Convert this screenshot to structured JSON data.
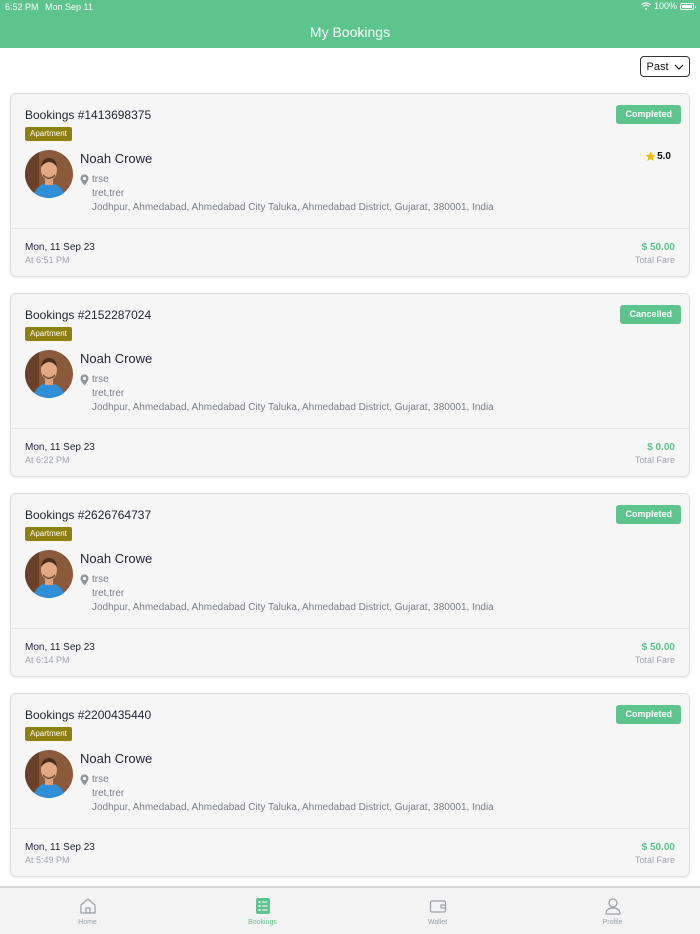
{
  "status_bar": {
    "time": "6:52 PM",
    "date": "Mon Sep 11",
    "battery": "100%"
  },
  "header": {
    "title": "My Bookings"
  },
  "filter": {
    "selected": "Past"
  },
  "bookings": [
    {
      "id_label": "Bookings #1413698375",
      "status": "Completed",
      "status_color": "#5cc48c",
      "tag": "Apartment",
      "name": "Noah Crowe",
      "rating": "5.0",
      "addr_line1": "trse",
      "addr_line2": "tret,trer",
      "addr_line3": "Jodhpur, Ahmedabad, Ahmedabad City Taluka, Ahmedabad District, Gujarat, 380001, India",
      "date": "Mon, 11 Sep 23",
      "time": "At 6:51 PM",
      "fare": "$ 50.00",
      "fare_label": "Total Fare"
    },
    {
      "id_label": "Bookings #2152287024",
      "status": "Cancelled",
      "status_color": "#5cc48c",
      "tag": "Apartment",
      "name": "Noah Crowe",
      "rating": "",
      "addr_line1": "trse",
      "addr_line2": "tret,trer",
      "addr_line3": "Jodhpur, Ahmedabad, Ahmedabad City Taluka, Ahmedabad District, Gujarat, 380001, India",
      "date": "Mon, 11 Sep 23",
      "time": "At 6:22 PM",
      "fare": "$ 0.00",
      "fare_label": "Total Fare"
    },
    {
      "id_label": "Bookings #2626764737",
      "status": "Completed",
      "status_color": "#5cc48c",
      "tag": "Apartment",
      "name": "Noah Crowe",
      "rating": "",
      "addr_line1": "trse",
      "addr_line2": "tret,trer",
      "addr_line3": "Jodhpur, Ahmedabad, Ahmedabad City Taluka, Ahmedabad District, Gujarat, 380001, India",
      "date": "Mon, 11 Sep 23",
      "time": "At 6:14 PM",
      "fare": "$ 50.00",
      "fare_label": "Total Fare"
    },
    {
      "id_label": "Bookings #2200435440",
      "status": "Completed",
      "status_color": "#5cc48c",
      "tag": "Apartment",
      "name": "Noah Crowe",
      "rating": "",
      "addr_line1": "trse",
      "addr_line2": "tret,trer",
      "addr_line3": "Jodhpur, Ahmedabad, Ahmedabad City Taluka, Ahmedabad District, Gujarat, 380001, India",
      "date": "Mon, 11 Sep 23",
      "time": "At 5:49 PM",
      "fare": "$ 50.00",
      "fare_label": "Total Fare"
    }
  ],
  "tabs": [
    {
      "label": "Home",
      "icon": "home-icon",
      "active": false
    },
    {
      "label": "Bookings",
      "icon": "bookings-icon",
      "active": true
    },
    {
      "label": "Wallet",
      "icon": "wallet-icon",
      "active": false
    },
    {
      "label": "Profile",
      "icon": "profile-icon",
      "active": false
    }
  ],
  "colors": {
    "brand": "#5cc48c",
    "tag": "#8d7f10",
    "star": "#f5b800"
  }
}
